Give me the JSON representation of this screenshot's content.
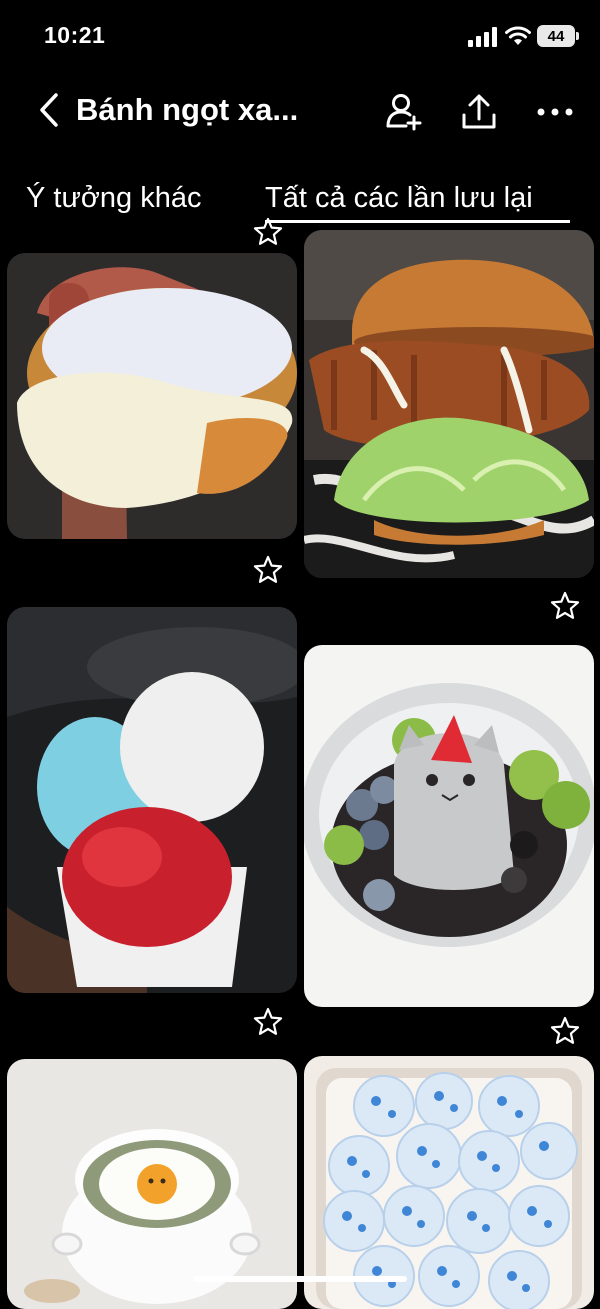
{
  "status_bar": {
    "time": "10:21",
    "battery": "44"
  },
  "header": {
    "title": "Bánh ngọt xa...",
    "icons": [
      "back-chevron-icon",
      "add-collaborator-icon",
      "share-icon",
      "more-icon"
    ]
  },
  "tabs": [
    {
      "label": "Ý tưởng khác",
      "active": false
    },
    {
      "label": "Tất cả các lần lưu lại",
      "active": true
    }
  ],
  "pins": [
    {
      "subject": "sugar-donut-cream",
      "starred": false
    },
    {
      "subject": "fried-chicken-burger",
      "starred": false
    },
    {
      "subject": "ice-cream-cup",
      "starred": false
    },
    {
      "subject": "cat-dessert-bowl",
      "starred": false
    },
    {
      "subject": "egg-rice-bowl",
      "starred": false
    },
    {
      "subject": "blue-spotted-mochi",
      "starred": false
    }
  ]
}
